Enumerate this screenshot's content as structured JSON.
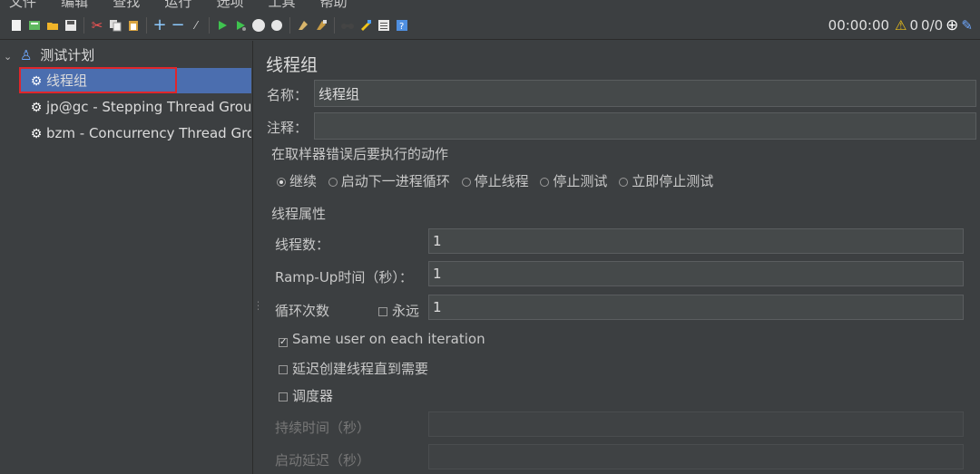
{
  "menu": [
    "文件",
    "编辑",
    "查找",
    "运行",
    "选项",
    "工具",
    "帮助"
  ],
  "toolbar": {
    "timer": "00:00:00",
    "warn_count": "0",
    "thread_count": "0/0"
  },
  "tree": {
    "root": "测试计划",
    "items": [
      "线程组",
      "jp@gc - Stepping Thread Group",
      "bzm - Concurrency Thread Grou"
    ]
  },
  "panel": {
    "title": "线程组",
    "name_label": "名称：",
    "name_value": "线程组",
    "comment_label": "注释：",
    "comment_value": "",
    "error_section": "在取样器错误后要执行的动作",
    "error_options": [
      "继续",
      "启动下一进程循环",
      "停止线程",
      "停止测试",
      "立即停止测试"
    ],
    "thread_section": "线程属性",
    "threads_label": "线程数：",
    "threads_value": "1",
    "rampup_label": "Ramp-Up时间（秒）：",
    "rampup_value": "1",
    "loop_label": "循环次数",
    "forever_label": "永远",
    "loop_value": "1",
    "same_user_label": "Same user on each iteration",
    "delay_label": "延迟创建线程直到需要",
    "scheduler_label": "调度器",
    "duration_label": "持续时间（秒）",
    "startup_delay_label": "启动延迟（秒）"
  }
}
